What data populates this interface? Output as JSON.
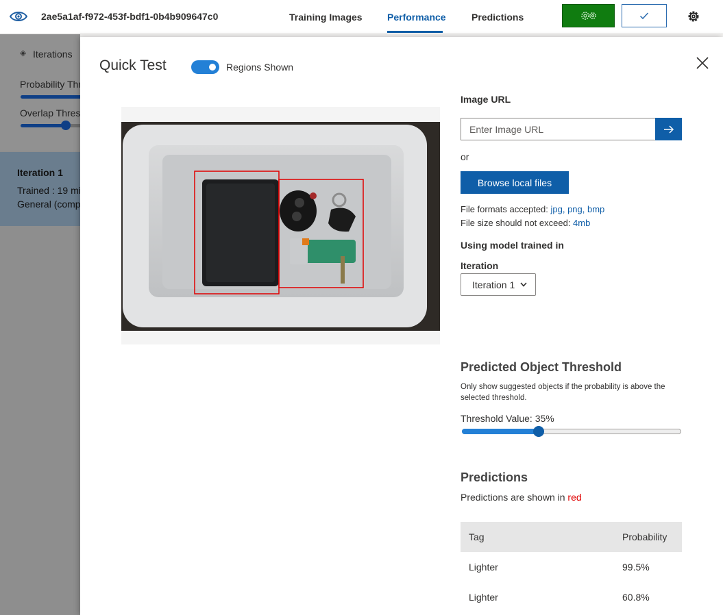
{
  "topbar": {
    "project_id": "2ae5a1af-f972-453f-bdf1-0b4b909647c0",
    "tabs": [
      {
        "label": "Training Images",
        "active": false
      },
      {
        "label": "Performance",
        "active": true
      },
      {
        "label": "Predictions",
        "active": false
      }
    ],
    "train_button_icon": "gears-icon",
    "quick_test_button_icon": "check-icon",
    "settings_icon": "gear-icon",
    "accent_color": "#0f5ea8",
    "train_color": "#107c10"
  },
  "background_panel": {
    "iterations_label": "Iterations",
    "probability_label": "Probability Thr",
    "overlap_label": "Overlap Thresh",
    "iteration_card": {
      "title": "Iteration 1",
      "trained": "Trained : 19 mi",
      "domain": "General (compa"
    }
  },
  "modal": {
    "title": "Quick Test",
    "regions_toggle_label": "Regions Shown",
    "regions_toggle_on": true,
    "image_url_label": "Image URL",
    "image_url_placeholder": "Enter Image URL",
    "or_text": "or",
    "browse_button": "Browse local files",
    "formats_prefix": "File formats accepted: ",
    "formats_value": "jpg, png, bmp",
    "size_prefix": "File size should not exceed: ",
    "size_value": "4mb",
    "model_label": "Using model trained in",
    "iteration_label": "Iteration",
    "iteration_selected": "Iteration 1",
    "threshold_title": "Predicted Object Threshold",
    "threshold_description": "Only show suggested objects if the probability is above the selected threshold.",
    "threshold_label": "Threshold Value: 35%",
    "threshold_value": 0.35,
    "predictions_title": "Predictions",
    "predictions_shown_prefix": "Predictions are shown in ",
    "predictions_shown_color_word": "red",
    "table": {
      "headers": [
        "Tag",
        "Probability"
      ],
      "rows": [
        {
          "tag": "Lighter",
          "probability": "99.5%"
        },
        {
          "tag": "Lighter",
          "probability": "60.8%"
        }
      ]
    },
    "prediction_box_color": "#e00000"
  }
}
